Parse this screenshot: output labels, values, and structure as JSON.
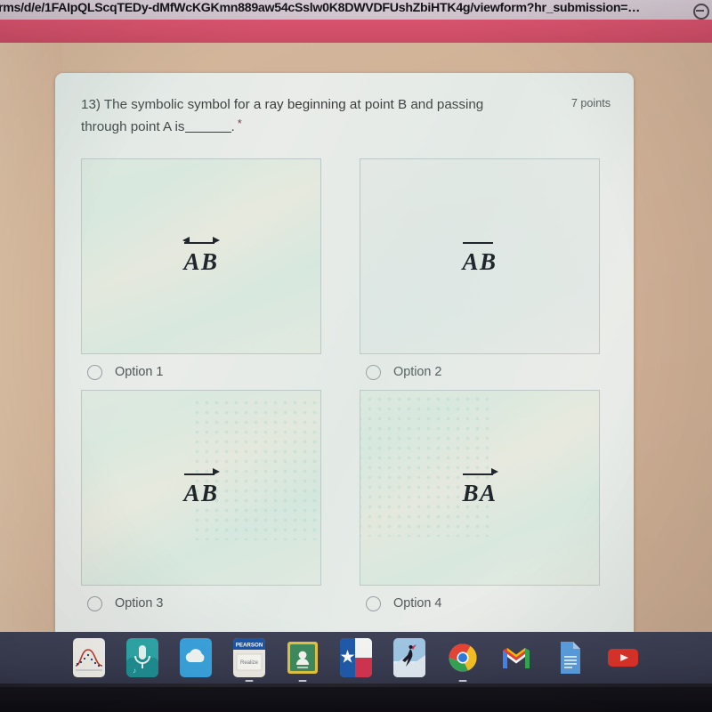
{
  "browser": {
    "url_text": "rms/d/e/1FAIpQLScqTEDy-dMfWcKGKmn889aw54cSslw0K8DWVDFUshZbiHTK4g/viewform?hr_submission=…",
    "right_icon": "account-circle-icon"
  },
  "theme": {
    "banner_color": "#d14f69",
    "page_background": "#cfb096",
    "card_background": "#e9ecea",
    "radio_border": "#8b9398",
    "text_color": "#1f2324"
  },
  "form": {
    "question_number": "13)",
    "question_text_part1": "The symbolic symbol for a ray beginning at point B and passing through point A is",
    "question_text_part2": ".",
    "required_marker": "*",
    "points_label": "7 points",
    "options": [
      {
        "id": "option-1",
        "label": "Option 1",
        "notation_letters": "AB",
        "notation_type": "line",
        "notation_description": "double-headed arrow over AB",
        "selected": false
      },
      {
        "id": "option-2",
        "label": "Option 2",
        "notation_letters": "AB",
        "notation_type": "segment",
        "notation_description": "overbar over AB",
        "selected": false
      },
      {
        "id": "option-3",
        "label": "Option 3",
        "notation_letters": "AB",
        "notation_type": "ray",
        "notation_description": "right arrow over AB",
        "selected": false
      },
      {
        "id": "option-4",
        "label": "Option 4",
        "notation_letters": "BA",
        "notation_type": "ray",
        "notation_description": "right arrow over BA",
        "selected": false
      }
    ]
  },
  "dock": {
    "items": [
      {
        "name": "graphing-calculator-icon",
        "label": "Desmos Graphing Calculator",
        "running": false
      },
      {
        "name": "sound-recorder-icon",
        "label": "Voice Recorder",
        "running": false
      },
      {
        "name": "cloud-app-icon",
        "label": "Cloud App",
        "running": false
      },
      {
        "name": "pearson-realize-icon",
        "label": "Pearson Realize",
        "running": true
      },
      {
        "name": "google-classroom-icon",
        "label": "Google Classroom",
        "running": true
      },
      {
        "name": "texas-flag-icon",
        "label": "Texas App",
        "running": false
      },
      {
        "name": "dancer-photo-icon",
        "label": "Photos",
        "running": false
      },
      {
        "name": "chrome-icon",
        "label": "Google Chrome",
        "running": true
      },
      {
        "name": "gmail-icon",
        "label": "Gmail",
        "running": false
      },
      {
        "name": "google-docs-icon",
        "label": "Google Docs",
        "running": false
      },
      {
        "name": "youtube-icon",
        "label": "YouTube",
        "running": false
      }
    ]
  }
}
